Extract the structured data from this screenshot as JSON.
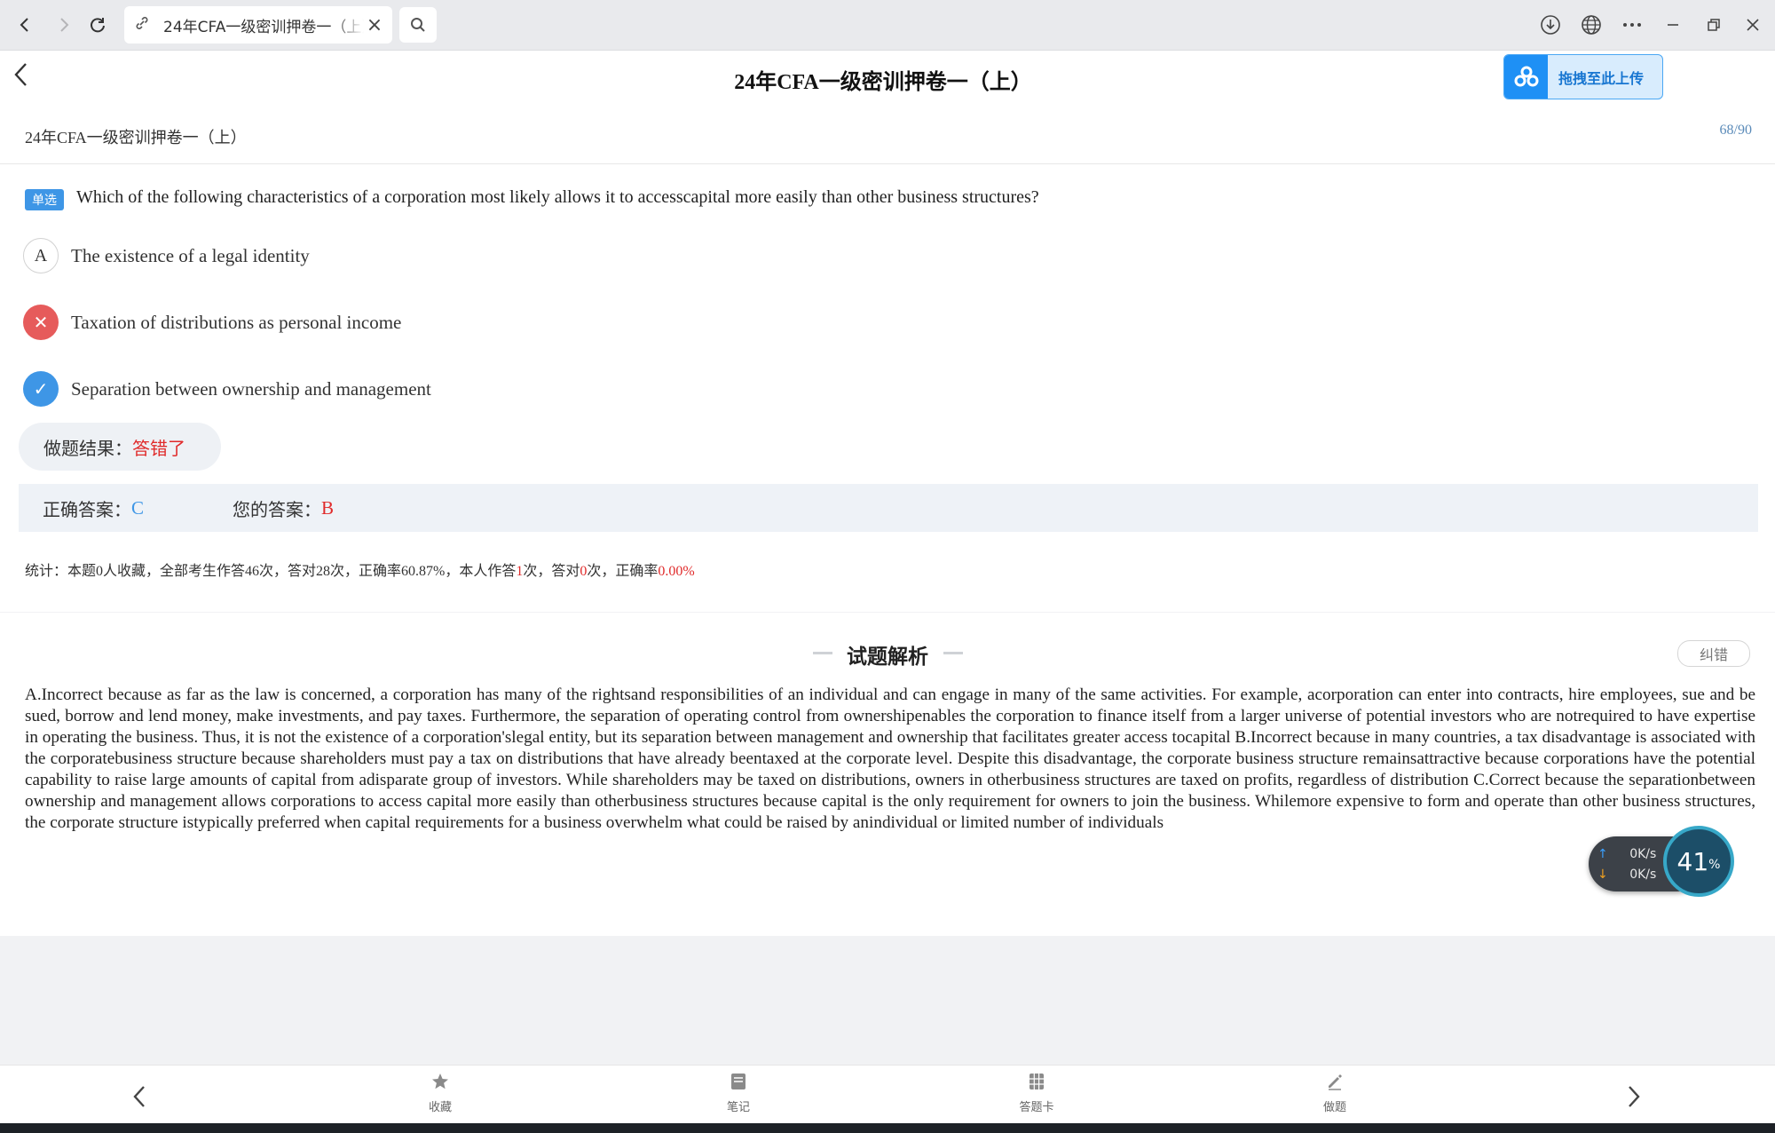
{
  "browser": {
    "tab_title": "24年CFA一级密训押卷一（上）",
    "icons": [
      "back-icon",
      "forward-icon",
      "reload-icon",
      "link-icon",
      "close-icon",
      "search-icon",
      "download-icon",
      "globe-icon",
      "more-icon",
      "minimize-icon",
      "restore-icon",
      "window-close-icon"
    ]
  },
  "header": {
    "title": "24年CFA一级密训押卷一（上）",
    "upload_label": "拖拽至此上传"
  },
  "paper": {
    "subtitle": "24年CFA一级密训押卷一（上）",
    "counter": "68/90"
  },
  "question": {
    "type_badge": "单选",
    "text": "Which of the following characteristics of a corporation most likely allows it to accesscapital more easily than other business structures?",
    "options": [
      {
        "marker": "A",
        "state": "unselected",
        "text": "The existence of a legal identity"
      },
      {
        "marker": "✕",
        "state": "wrong",
        "text": "Taxation of distributions as personal income"
      },
      {
        "marker": "✓",
        "state": "correct",
        "text": "Separation between ownership and management"
      }
    ]
  },
  "result": {
    "label": "做题结果：",
    "value": "答错了"
  },
  "answers": {
    "correct_label": "正确答案：",
    "correct_value": "C",
    "yours_label": "您的答案：",
    "yours_value": "B"
  },
  "stats": {
    "p1": "统计：本题0人收藏，全部考生作答46次，答对28次，正确率60.87%，本人作答",
    "self_count": "1",
    "p2": "次，答对",
    "self_correct": "0",
    "p3": "次，正确率",
    "self_rate": "0.00%"
  },
  "analysis": {
    "title": "试题解析",
    "report_label": "纠错",
    "text": "A.Incorrect because as far as the law is concerned, a corporation has many of the rightsand responsibilities of an individual and can engage in many of the same activities. For example, acorporation can enter into contracts, hire employees, sue and be sued, borrow and lend money, make investments, and pay taxes. Furthermore, the separation of operating control from ownershipenables the corporation to finance itself from a larger universe of potential investors who are notrequired to have expertise in operating the business. Thus, it is not the existence of a corporation'slegal entity, but its separation between management and ownership that facilitates greater access tocapital B.Incorrect because in many countries, a tax disadvantage is associated with the corporatebusiness structure because shareholders must pay a tax on distributions that have already beentaxed at the corporate level. Despite this disadvantage, the corporate business structure remainsattractive because corporations have the potential capability to raise large amounts of capital from adisparate group of investors. While shareholders may be taxed on distributions, owners in otherbusiness structures are taxed on profits, regardless of distribution C.Correct because the separationbetween ownership and management allows corporations to access capital more easily than otherbusiness structures because capital is the only requirement for owners to join the business. Whilemore expensive to form and operate than other business structures, the corporate structure istypically preferred when capital requirements for a business overwhelm what could be raised by anindividual or limited number of individuals"
  },
  "speed_widget": {
    "up": "0K/s",
    "down": "0K/s",
    "percent": "41",
    "percent_unit": "%"
  },
  "bottom_nav": {
    "items": [
      {
        "label": "收藏",
        "icon": "star-icon"
      },
      {
        "label": "笔记",
        "icon": "note-icon"
      },
      {
        "label": "答题卡",
        "icon": "answer-card-icon"
      },
      {
        "label": "做题",
        "icon": "pencil-icon"
      }
    ]
  },
  "colors": {
    "accent_blue": "#3e96e6",
    "error_red": "#e02a2a",
    "wrong_circle": "#e65b5b"
  }
}
